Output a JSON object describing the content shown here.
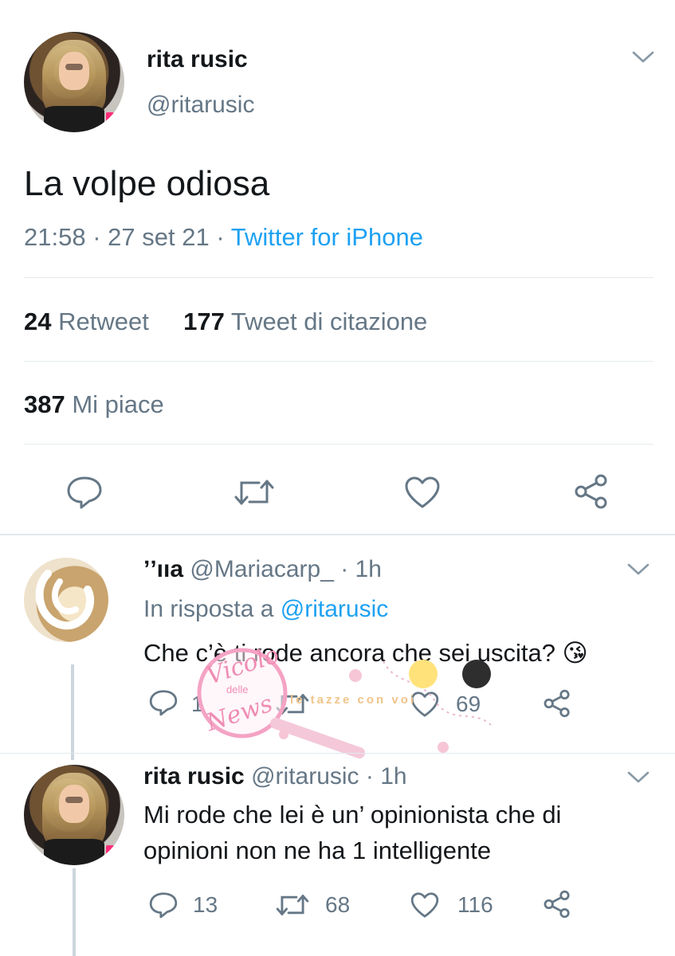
{
  "main_tweet": {
    "author_name": "rita rusic",
    "author_handle": "@ritarusic",
    "text": "La volpe odiosa",
    "time": "21:58",
    "separator": "·",
    "date": "27 set 21",
    "source": "Twitter for iPhone",
    "stats": {
      "retweets_count": "24",
      "retweets_label": "Retweet",
      "quotes_count": "177",
      "quotes_label": "Tweet di citazione",
      "likes_count": "387",
      "likes_label": "Mi piace"
    }
  },
  "replies": [
    {
      "author_name": "ʼʼııa",
      "author_handle": "@Mariacarp_",
      "time": "· 1h",
      "in_reply_prefix": "In risposta a",
      "in_reply_handle": "@ritarusic",
      "text": "Che c’è ti rode ancora che sei uscita? 😘",
      "reply_count": "1",
      "retweet_count": "",
      "like_count": "69"
    },
    {
      "author_name": "rita rusic",
      "author_handle": "@ritarusic",
      "time": "· 1h",
      "text_line1": "Mi rode che lei è un’ opinionista che di",
      "text_line2": "opinioni non ne ha 1 intelligente",
      "reply_count": "13",
      "retweet_count": "68",
      "like_count": "116"
    }
  ],
  "watermark": {
    "line1": "Vicolo",
    "line2": "delle",
    "line3": "News",
    "tagline": "le tazze con voi"
  },
  "colors": {
    "accent": "#1da1f2",
    "text": "#14171a",
    "muted": "#657786",
    "divider": "#e6ecf0",
    "watermark_pink": "#f4a3c4"
  }
}
